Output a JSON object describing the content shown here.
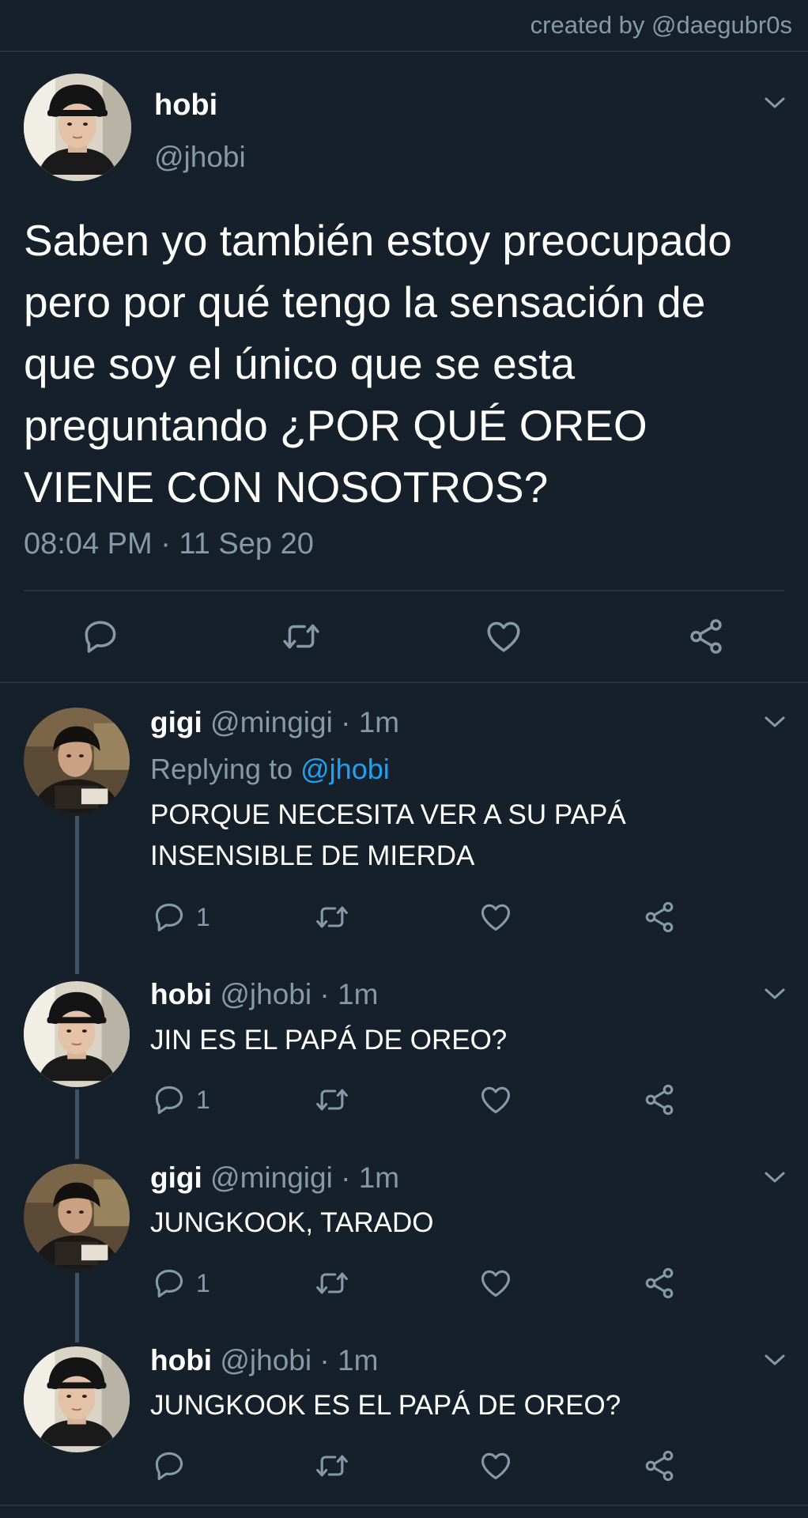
{
  "credit": "created by @daegubr0s",
  "main_tweet": {
    "name": "hobi",
    "handle": "@jhobi",
    "text": "Saben yo también estoy preocupado pero por qué tengo la sensación de que soy el único que se esta preguntando ¿POR QUÉ OREO VIENE CON NOSOTROS?",
    "timestamp": "08:04 PM · 11 Sep 20"
  },
  "replies": [
    {
      "name": "gigi",
      "meta": "@mingigi · 1m",
      "replying_prefix": "Replying to",
      "replying_to": "@jhobi",
      "text": "PORQUE NECESITA VER A SU PAPÁ INSENSIBLE DE MIERDA",
      "reply_count": "1"
    },
    {
      "name": "hobi",
      "meta": "@jhobi · 1m",
      "text": "JIN ES EL PAPÁ DE OREO?",
      "reply_count": "1"
    },
    {
      "name": "gigi",
      "meta": "@mingigi · 1m",
      "text": "JUNGKOOK, TARADO",
      "reply_count": "1"
    },
    {
      "name": "hobi",
      "meta": "@jhobi · 1m",
      "text": "JUNGKOOK ES EL PAPÁ DE OREO?",
      "reply_count": ""
    }
  ],
  "icons": {
    "reply": "reply-icon",
    "retweet": "retweet-icon",
    "like": "heart-icon",
    "share": "share-icon",
    "more": "chevron-down-icon"
  },
  "colors": {
    "background": "#15202b",
    "secondary_text": "#8899a6",
    "link": "#1da1f2",
    "divider": "#253341"
  }
}
